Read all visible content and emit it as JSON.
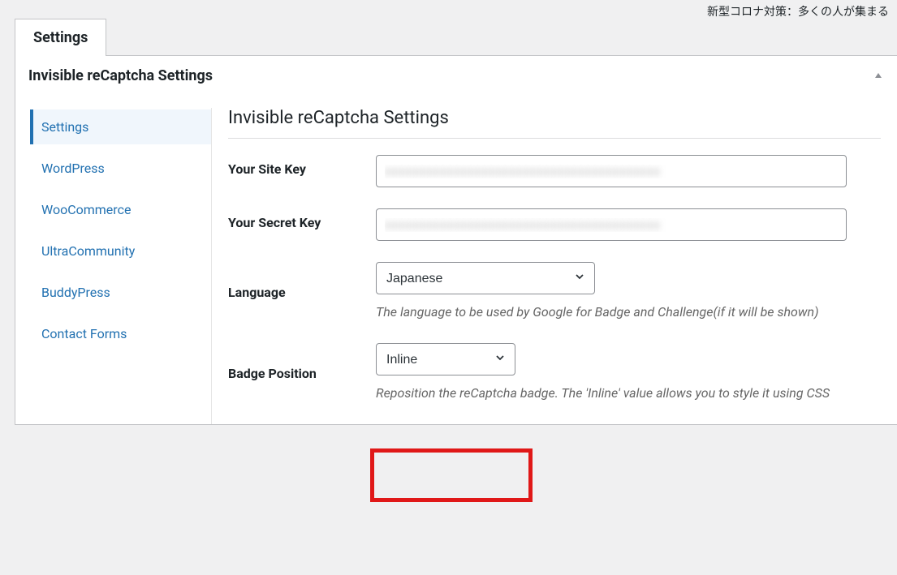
{
  "notice": "新型コロナ対策：多くの人が集まる",
  "tabs": {
    "settings": "Settings"
  },
  "panel": {
    "title": "Invisible reCaptcha Settings"
  },
  "sidebar": {
    "items": [
      "Settings",
      "WordPress",
      "WooCommerce",
      "UltraCommunity",
      "BuddyPress",
      "Contact Forms"
    ]
  },
  "main": {
    "title": "Invisible reCaptcha Settings",
    "siteKeyLabel": "Your Site Key",
    "siteKeyValue": "xxxxxxxxxxxxxxxxxxxxxxxxxxxxxxxxxxxxxxxx",
    "secretKeyLabel": "Your Secret Key",
    "secretKeyValue": "xxxxxxxxxxxxxxxxxxxxxxxxxxxxxxxxxxxxxxxx",
    "languageLabel": "Language",
    "languageValue": "Japanese",
    "languageHelp": "The language to be used by Google for Badge and Challenge(if it will be shown)",
    "badgeLabel": "Badge Position",
    "badgeValue": "Inline",
    "badgeHelp": "Reposition the reCaptcha badge. The 'Inline' value allows you to style it using CSS"
  }
}
